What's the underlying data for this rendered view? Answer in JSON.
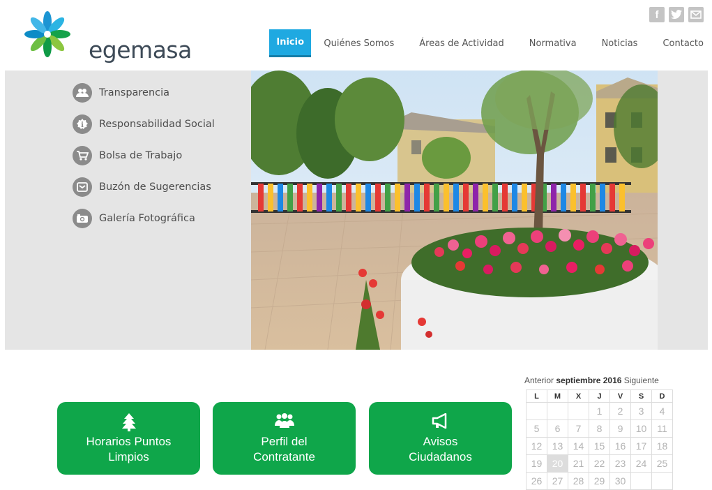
{
  "brand": {
    "name": "egemasa"
  },
  "social": [
    {
      "name": "facebook",
      "glyph": "f"
    },
    {
      "name": "twitter",
      "glyph": "t"
    },
    {
      "name": "email",
      "glyph": "✉"
    }
  ],
  "nav": [
    {
      "label": "Inicio",
      "active": true
    },
    {
      "label": "Quiénes Somos"
    },
    {
      "label": "Áreas de Actividad"
    },
    {
      "label": "Normativa"
    },
    {
      "label": "Noticias"
    },
    {
      "label": "Contacto"
    }
  ],
  "side_menu": [
    {
      "label": "Transparencia",
      "icon": "users-icon"
    },
    {
      "label": "Responsabilidad Social",
      "icon": "info-icon"
    },
    {
      "label": "Bolsa de Trabajo",
      "icon": "cart-icon"
    },
    {
      "label": "Buzón de Sugerencias",
      "icon": "mail-icon"
    },
    {
      "label": "Galería Fotográfica",
      "icon": "camera-icon"
    }
  ],
  "tiles": [
    {
      "line1": "Horarios Puntos",
      "line2": "Limpios",
      "icon": "tree-icon"
    },
    {
      "line1": "Perfil del",
      "line2": "Contratante",
      "icon": "group-icon"
    },
    {
      "line1": "Avisos",
      "line2": "Ciudadanos",
      "icon": "megaphone-icon"
    }
  ],
  "calendar": {
    "prev": "Anterior",
    "month": "septiembre",
    "year": "2016",
    "next": "Siguiente",
    "weekdays": [
      "L",
      "M",
      "X",
      "J",
      "V",
      "S",
      "D"
    ],
    "weeks": [
      [
        "",
        "",
        "",
        "1",
        "2",
        "3",
        "4"
      ],
      [
        "5",
        "6",
        "7",
        "8",
        "9",
        "10",
        "11"
      ],
      [
        "12",
        "13",
        "14",
        "15",
        "16",
        "17",
        "18"
      ],
      [
        "19",
        "20",
        "21",
        "22",
        "23",
        "24",
        "25"
      ],
      [
        "26",
        "27",
        "28",
        "29",
        "30",
        "",
        ""
      ]
    ],
    "today": "20"
  }
}
